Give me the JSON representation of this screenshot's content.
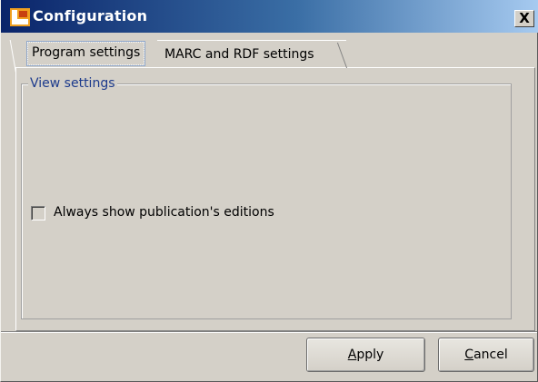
{
  "window": {
    "title": "Configuration",
    "icon": "app-logo-icon",
    "close_label": "X"
  },
  "tabs": [
    {
      "label": "Program settings",
      "selected": true
    },
    {
      "label": "MARC and RDF settings",
      "selected": false
    }
  ],
  "view_settings": {
    "group_label": "View settings",
    "always_show_editions": {
      "label": "Always show publication's editions",
      "checked": false
    }
  },
  "footer": {
    "apply_label": "Apply",
    "cancel_label": "Cancel"
  },
  "colors": {
    "titlebar_start": "#0a246a",
    "titlebar_end": "#a6caf0",
    "window_bg": "#d4d0c8",
    "group_label": "#1c3a8c"
  }
}
